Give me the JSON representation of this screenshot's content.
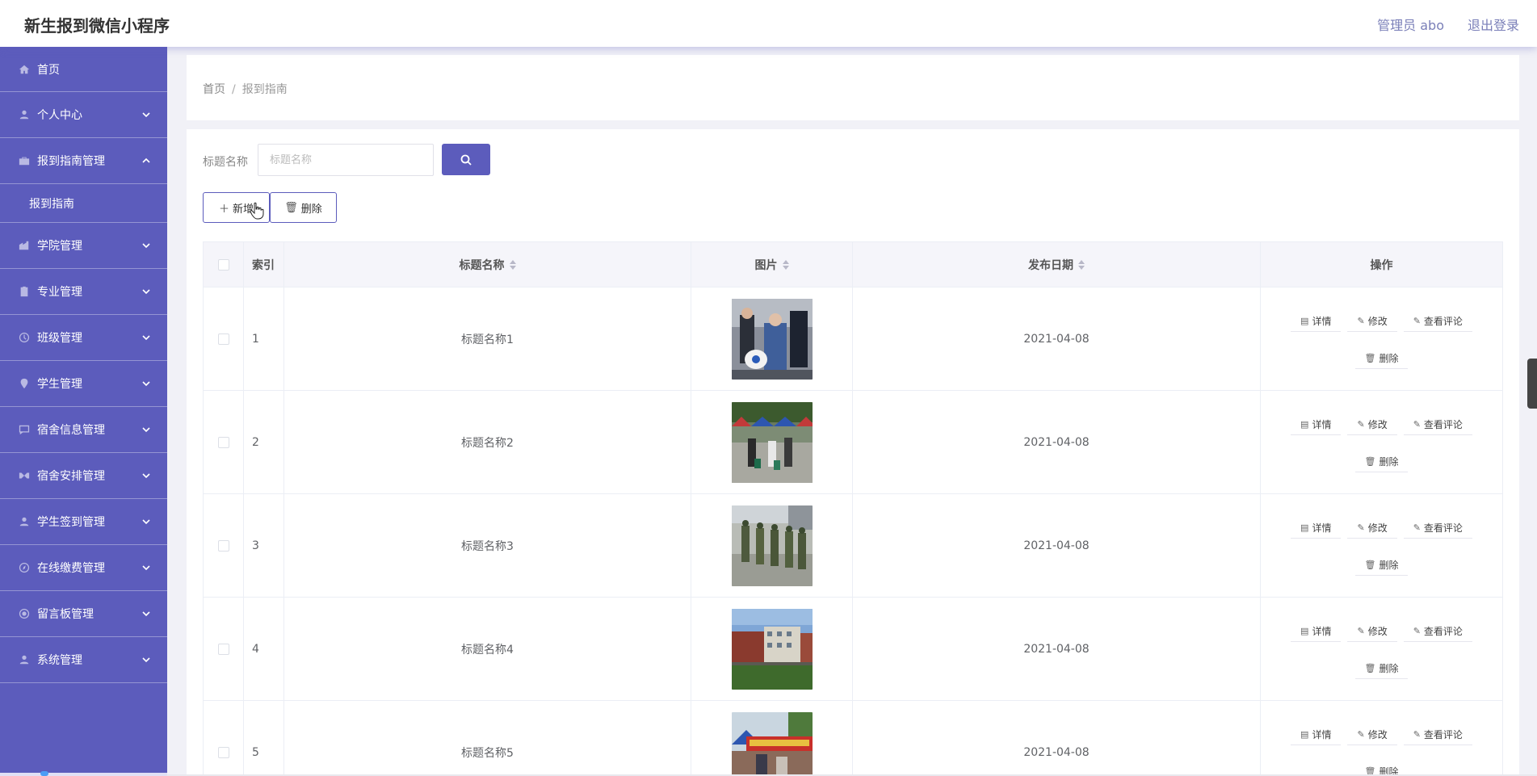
{
  "header": {
    "title": "新生报到微信小程序",
    "admin": "管理员 abo",
    "logout": "退出登录"
  },
  "sidebar": {
    "items": [
      {
        "label": "首页",
        "icon": "home-icon"
      },
      {
        "label": "个人中心",
        "icon": "user-icon"
      },
      {
        "label": "报到指南管理",
        "icon": "briefcase-icon",
        "expanded": true
      },
      {
        "label": "学院管理",
        "icon": "building-icon"
      },
      {
        "label": "专业管理",
        "icon": "clipboard-icon"
      },
      {
        "label": "班级管理",
        "icon": "clock-icon"
      },
      {
        "label": "学生管理",
        "icon": "pin-icon"
      },
      {
        "label": "宿舍信息管理",
        "icon": "chat-icon"
      },
      {
        "label": "宿舍安排管理",
        "icon": "bed-icon"
      },
      {
        "label": "学生签到管理",
        "icon": "user-icon"
      },
      {
        "label": "在线缴费管理",
        "icon": "compass-icon"
      },
      {
        "label": "留言板管理",
        "icon": "target-icon"
      },
      {
        "label": "系统管理",
        "icon": "user-icon"
      }
    ],
    "submenu": "报到指南"
  },
  "breadcrumb": {
    "home": "首页",
    "separator": "/",
    "current": "报到指南"
  },
  "search": {
    "label": "标题名称",
    "placeholder": "标题名称"
  },
  "actions": {
    "add": "新增",
    "delete": "删除"
  },
  "table": {
    "headers": {
      "index": "索引",
      "title": "标题名称",
      "image": "图片",
      "date": "发布日期",
      "ops": "操作"
    },
    "op_labels": {
      "detail": "详情",
      "edit": "修改",
      "comments": "查看评论",
      "delete": "删除"
    },
    "rows": [
      {
        "index": "1",
        "title": "标题名称1",
        "date": "2021-04-08"
      },
      {
        "index": "2",
        "title": "标题名称2",
        "date": "2021-04-08"
      },
      {
        "index": "3",
        "title": "标题名称3",
        "date": "2021-04-08"
      },
      {
        "index": "4",
        "title": "标题名称4",
        "date": "2021-04-08"
      },
      {
        "index": "5",
        "title": "标题名称5",
        "date": "2021-04-08"
      }
    ]
  },
  "colors": {
    "accent": "#5c5cbc",
    "sidebar": "#5c5cbc"
  }
}
